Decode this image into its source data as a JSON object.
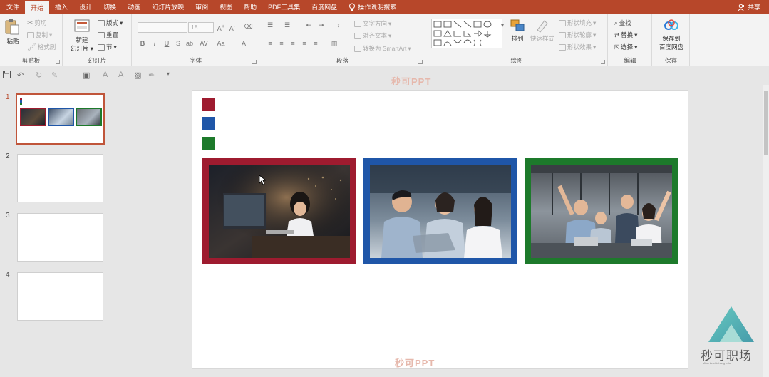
{
  "menu": {
    "tabs": [
      "文件",
      "开始",
      "插入",
      "设计",
      "切换",
      "动画",
      "幻灯片放映",
      "审阅",
      "视图",
      "帮助",
      "PDF工具集",
      "百度网盘"
    ],
    "active_tab": "开始",
    "tell_me": "操作说明搜索",
    "share": "共享"
  },
  "ribbon": {
    "clipboard": {
      "label": "剪贴板",
      "paste": "粘贴",
      "cut": "剪切",
      "copy": "复制",
      "format_painter": "格式刷"
    },
    "slides": {
      "label": "幻灯片",
      "new_slide_1": "新建",
      "new_slide_2": "幻灯片",
      "layout": "版式",
      "reset": "重置",
      "section": "节"
    },
    "font": {
      "label": "字体",
      "font_name": "",
      "font_size": "18"
    },
    "paragraph": {
      "label": "段落",
      "text_direction": "文字方向",
      "align_text": "对齐文本",
      "smartart": "转换为 SmartArt"
    },
    "drawing": {
      "label": "绘图",
      "arrange": "排列",
      "quick_styles": "快速样式",
      "shape_fill": "形状填充",
      "shape_outline": "形状轮廓",
      "shape_effects": "形状效果"
    },
    "editing": {
      "label": "编辑",
      "find": "查找",
      "replace": "替换",
      "select": "选择"
    },
    "save": {
      "label": "保存",
      "save_to_1": "保存到",
      "save_to_2": "百度网盘"
    }
  },
  "watermark": {
    "top": "秒可PPT",
    "bottom": "秒可PPT"
  },
  "thumbnails": [
    "1",
    "2",
    "3",
    "4"
  ],
  "brand": {
    "name": "秒可职场",
    "sub": "Miao ke zhichang edu"
  },
  "colors": {
    "accent": "#b7472a",
    "red": "#9e1b2f",
    "blue": "#1f56a8",
    "green": "#1d7a2b"
  }
}
